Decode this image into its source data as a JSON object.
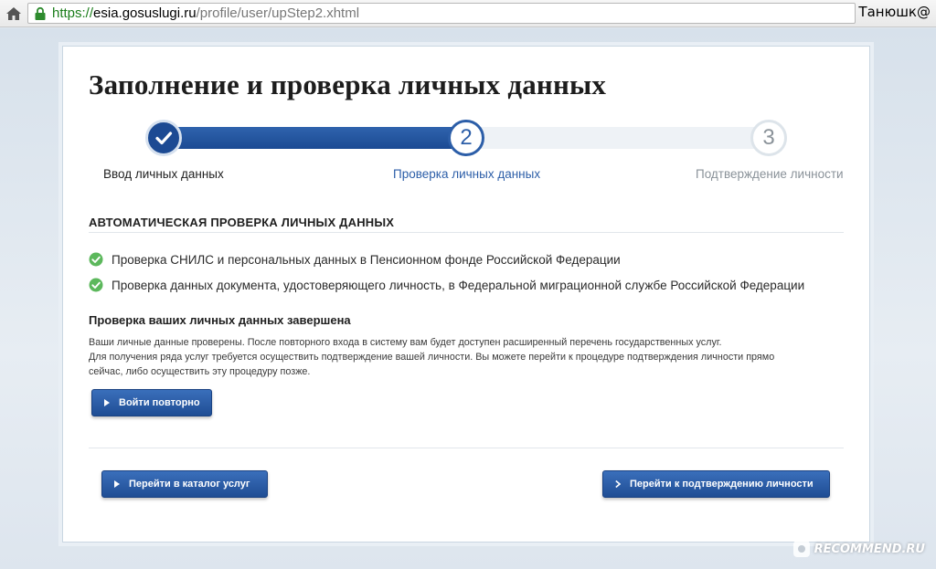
{
  "browser": {
    "url_scheme": "https://",
    "url_host": "esia.gosuslugi.ru",
    "url_path": "/profile/user/upStep2.xhtml",
    "user_name": "Танюшк@"
  },
  "page": {
    "title": "Заполнение и проверка личных данных"
  },
  "progress": {
    "current_step": 2,
    "steps": [
      {
        "number": "",
        "label": "Ввод личных данных",
        "state": "done"
      },
      {
        "number": "2",
        "label": "Проверка личных данных",
        "state": "active"
      },
      {
        "number": "3",
        "label": "Подтверждение личности",
        "state": "pending"
      }
    ]
  },
  "auto_check": {
    "title": "АВТОМАТИЧЕСКАЯ ПРОВЕРКА ЛИЧНЫХ ДАННЫХ",
    "items": [
      "Проверка СНИЛС и персональных данных в Пенсионном фонде Российской Федерации",
      "Проверка данных документа, удостоверяющего личность, в Федеральной миграционной службе Российской Федерации"
    ]
  },
  "result": {
    "title": "Проверка ваших личных данных завершена",
    "lines": [
      "Ваши личные данные проверены. После повторного входа в систему вам будет доступен расширенный перечень государственных услуг.",
      "Для получения ряда услуг требуется осуществить подтверждение вашей личности. Вы можете перейти к процедуре подтверждения личности прямо",
      "сейчас, либо осуществить эту процедуру позже."
    ],
    "retry_button": "Войти повторно"
  },
  "footer": {
    "catalog_button": "Перейти в каталог услуг",
    "confirm_button": "Перейти к подтверждению личности"
  },
  "watermark": {
    "text": "RECOMMEND.RU"
  },
  "colors": {
    "primary": "#1f4d94",
    "success": "#5cb85c",
    "muted": "#8a9299"
  }
}
